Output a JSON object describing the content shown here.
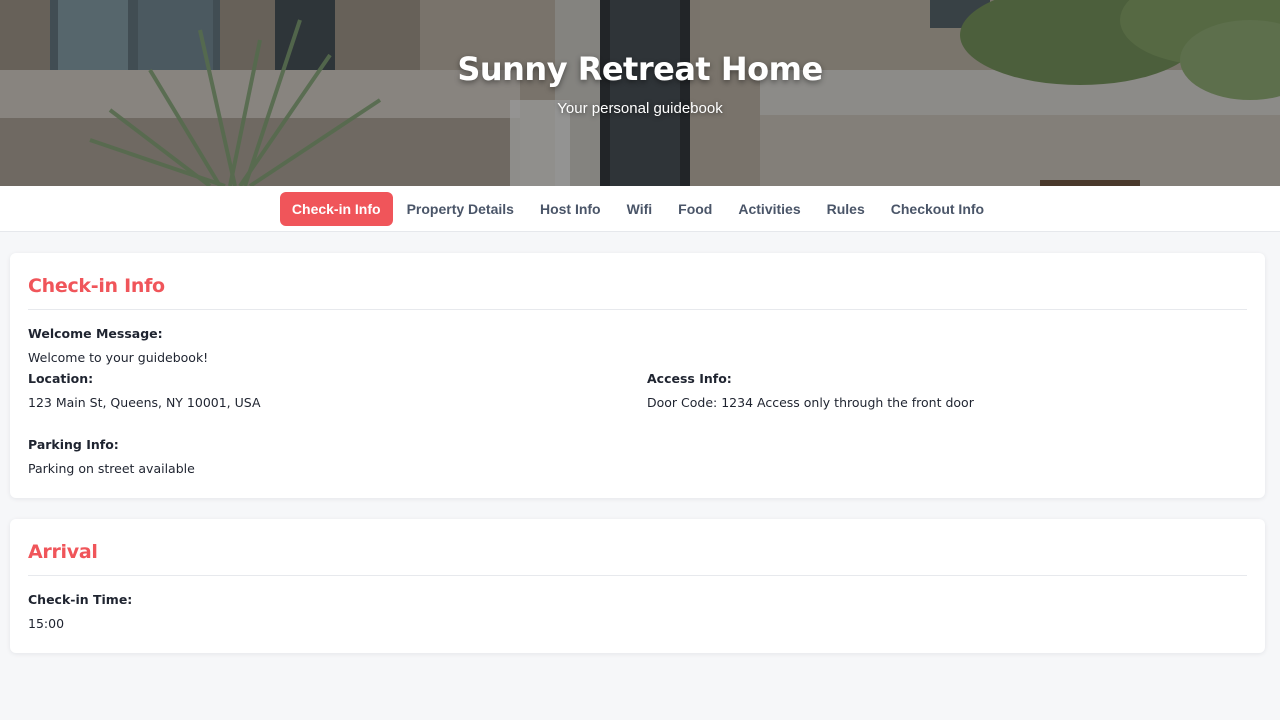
{
  "hero": {
    "title": "Sunny Retreat Home",
    "subtitle": "Your personal guidebook"
  },
  "nav": {
    "tabs": [
      {
        "label": "Check-in Info",
        "active": true
      },
      {
        "label": "Property Details",
        "active": false
      },
      {
        "label": "Host Info",
        "active": false
      },
      {
        "label": "Wifi",
        "active": false
      },
      {
        "label": "Food",
        "active": false
      },
      {
        "label": "Activities",
        "active": false
      },
      {
        "label": "Rules",
        "active": false
      },
      {
        "label": "Checkout Info",
        "active": false
      }
    ]
  },
  "checkin": {
    "title": "Check-in Info",
    "welcome_label": "Welcome Message:",
    "welcome_value": "Welcome to your guidebook!",
    "location_label": "Location:",
    "location_value": "123 Main St, Queens, NY 10001, USA",
    "access_label": "Access Info:",
    "access_value": "Door Code: 1234 Access only through the front door",
    "parking_label": "Parking Info:",
    "parking_value": "Parking on street available"
  },
  "arrival": {
    "title": "Arrival",
    "time_label": "Check-in Time:",
    "time_value": "15:00"
  },
  "colors": {
    "accent": "#f0555a",
    "nav_text": "#4a5568",
    "page_bg": "#f6f7f9"
  }
}
